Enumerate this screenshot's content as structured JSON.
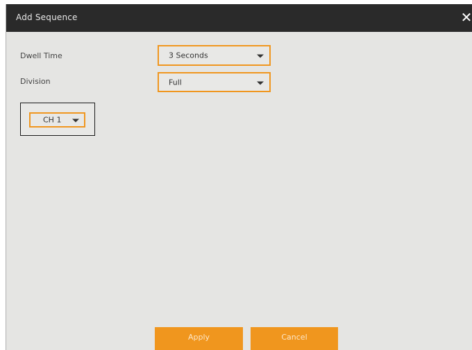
{
  "dialog": {
    "title": "Add Sequence",
    "close_icon": "close-icon",
    "close_glyph": "✕"
  },
  "form": {
    "dwell_time": {
      "label": "Dwell Time",
      "value": "3 Seconds"
    },
    "division": {
      "label": "Division",
      "value": "Full"
    }
  },
  "channels": [
    {
      "value": "CH 1"
    }
  ],
  "buttons": {
    "apply_label": "Apply",
    "cancel_label": "Cancel"
  },
  "colors": {
    "accent": "#f0961e",
    "titlebar": "#2a2a2a",
    "panel": "#e5e5e3"
  }
}
